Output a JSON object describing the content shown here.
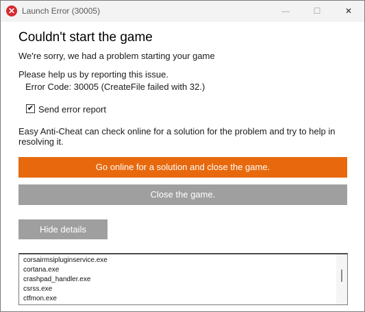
{
  "window": {
    "title": "Launch Error (30005)",
    "controls": {
      "minimize": "—",
      "maximize": "☐",
      "close": "✕"
    },
    "title_icon": "error-icon"
  },
  "content": {
    "heading": "Couldn't start the game",
    "sorry": "We're sorry, we had a problem starting your game",
    "help": "Please help us by reporting this issue.",
    "error_code": "Error Code: 30005 (CreateFile failed with 32.)",
    "send_report_label": "Send error report",
    "send_report_checked": true,
    "eac_text": "Easy Anti-Cheat can check online for a solution for the problem and try to help in resolving it."
  },
  "buttons": {
    "online": "Go online for a solution and close the game.",
    "close_game": "Close the game.",
    "hide_details": "Hide details"
  },
  "details": {
    "items": [
      "corsairmsipluginservice.exe",
      "cortana.exe",
      "crashpad_handler.exe",
      "csrss.exe",
      "ctfmon.exe"
    ]
  },
  "colors": {
    "accent_orange": "#e8690d",
    "button_gray": "#9f9f9f"
  }
}
